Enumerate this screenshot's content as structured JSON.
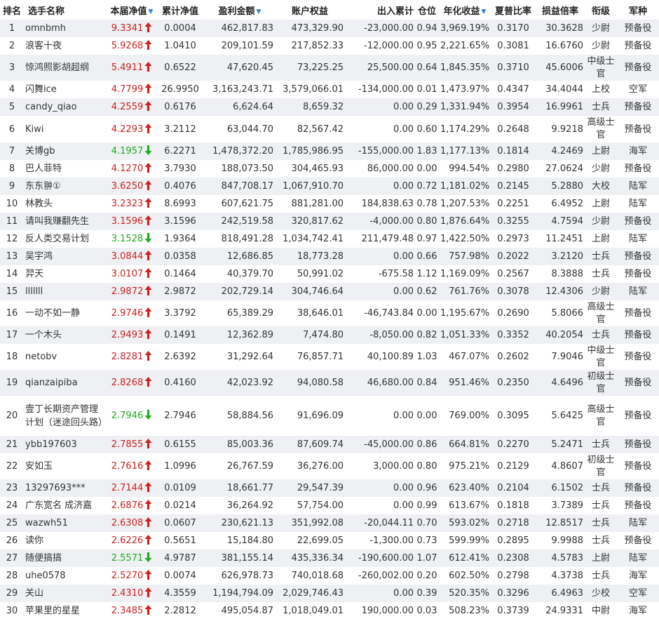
{
  "colors": {
    "up": "#cc2222",
    "down": "#22aa22",
    "sort_icon": "#2f7fd6",
    "stripe": "#eef0f3"
  },
  "headers": {
    "rank": "排名",
    "name": "选手名称",
    "nav": "本届净值",
    "cum_nav": "累计净值",
    "profit": "盈利金额",
    "equity": "账户权益",
    "inout": "出入累计",
    "position": "仓位",
    "annual": "年化收益",
    "sharpe": "夏普比率",
    "pl_ratio": "损益倍率",
    "rank_title": "衔级",
    "branch": "军种"
  },
  "sort_icons": {
    "nav": "sort-down-icon",
    "profit": "sort-down-icon",
    "annual": "sort-down-icon"
  },
  "rows": [
    {
      "rank": "1",
      "name": "omnbmh",
      "nav": "9.3341",
      "dir": "up",
      "cum_nav": "0.0004",
      "profit": "462,817.83",
      "equity": "473,329.90",
      "inout": "-23,000.00",
      "position": "0.94",
      "annual": "3,969.19%",
      "sharpe": "0.3170",
      "pl_ratio": "30.3628",
      "title": "少尉",
      "branch": "预备役"
    },
    {
      "rank": "2",
      "name": "浪客十夜",
      "nav": "5.9268",
      "dir": "up",
      "cum_nav": "1.0410",
      "profit": "209,101.59",
      "equity": "217,852.33",
      "inout": "-12,000.00",
      "position": "0.95",
      "annual": "2,221.65%",
      "sharpe": "0.3081",
      "pl_ratio": "16.6760",
      "title": "少尉",
      "branch": "预备役"
    },
    {
      "rank": "3",
      "name": "惊鸿照影胡超纲",
      "nav": "5.4911",
      "dir": "up",
      "cum_nav": "0.6522",
      "profit": "47,620.45",
      "equity": "73,225.25",
      "inout": "25,500.00",
      "position": "0.64",
      "annual": "1,845.35%",
      "sharpe": "0.3710",
      "pl_ratio": "45.6006",
      "title": "中级士官",
      "branch": "预备役"
    },
    {
      "rank": "4",
      "name": "闪舞ice",
      "nav": "4.7799",
      "dir": "up",
      "cum_nav": "26.9950",
      "profit": "3,163,243.71",
      "equity": "3,579,066.01",
      "inout": "-134,000.00",
      "position": "0.01",
      "annual": "1,473.97%",
      "sharpe": "0.4347",
      "pl_ratio": "34.4044",
      "title": "上校",
      "branch": "空军"
    },
    {
      "rank": "5",
      "name": "candy_qiao",
      "nav": "4.2559",
      "dir": "up",
      "cum_nav": "0.6176",
      "profit": "6,624.64",
      "equity": "8,659.32",
      "inout": "0.00",
      "position": "0.29",
      "annual": "1,331.94%",
      "sharpe": "0.3954",
      "pl_ratio": "16.9961",
      "title": "士兵",
      "branch": "预备役"
    },
    {
      "rank": "6",
      "name": "Kiwi",
      "nav": "4.2293",
      "dir": "up",
      "cum_nav": "3.2112",
      "profit": "63,044.70",
      "equity": "82,567.42",
      "inout": "0.00",
      "position": "0.60",
      "annual": "1,174.29%",
      "sharpe": "0.2648",
      "pl_ratio": "9.9218",
      "title": "高级士官",
      "branch": "预备役"
    },
    {
      "rank": "7",
      "name": "关博gb",
      "nav": "4.1957",
      "dir": "down",
      "cum_nav": "6.2271",
      "profit": "1,478,372.20",
      "equity": "1,785,986.95",
      "inout": "-155,000.00",
      "position": "1.83",
      "annual": "1,177.13%",
      "sharpe": "0.1814",
      "pl_ratio": "4.2469",
      "title": "上尉",
      "branch": "海军"
    },
    {
      "rank": "8",
      "name": "巴人菲特",
      "nav": "4.1270",
      "dir": "up",
      "cum_nav": "3.7930",
      "profit": "188,073.50",
      "equity": "304,465.93",
      "inout": "86,000.00",
      "position": "0.00",
      "annual": "994.54%",
      "sharpe": "0.2980",
      "pl_ratio": "27.0624",
      "title": "少尉",
      "branch": "预备役"
    },
    {
      "rank": "9",
      "name": "东东翀①",
      "nav": "3.6250",
      "dir": "up",
      "cum_nav": "0.4076",
      "profit": "847,708.17",
      "equity": "1,067,910.70",
      "inout": "0.00",
      "position": "0.72",
      "annual": "1,181.02%",
      "sharpe": "0.2145",
      "pl_ratio": "5.2880",
      "title": "大校",
      "branch": "陆军"
    },
    {
      "rank": "10",
      "name": "林教头",
      "nav": "3.2323",
      "dir": "up",
      "cum_nav": "8.6993",
      "profit": "607,621.75",
      "equity": "881,281.00",
      "inout": "184,838.63",
      "position": "0.78",
      "annual": "1,207.53%",
      "sharpe": "0.2251",
      "pl_ratio": "6.4952",
      "title": "上尉",
      "branch": "陆军"
    },
    {
      "rank": "11",
      "name": "请叫我赚翻先生",
      "nav": "3.1596",
      "dir": "up",
      "cum_nav": "3.1596",
      "profit": "242,519.58",
      "equity": "320,817.62",
      "inout": "-4,000.00",
      "position": "0.80",
      "annual": "1,876.64%",
      "sharpe": "0.3255",
      "pl_ratio": "4.7594",
      "title": "少尉",
      "branch": "预备役"
    },
    {
      "rank": "12",
      "name": "反人类交易计划",
      "nav": "3.1528",
      "dir": "down",
      "cum_nav": "1.9364",
      "profit": "818,491.28",
      "equity": "1,034,742.41",
      "inout": "211,479.48",
      "position": "0.97",
      "annual": "1,422.50%",
      "sharpe": "0.2973",
      "pl_ratio": "11.2451",
      "title": "上尉",
      "branch": "陆军"
    },
    {
      "rank": "13",
      "name": "吴宇鸿",
      "nav": "3.0844",
      "dir": "up",
      "cum_nav": "0.0358",
      "profit": "12,686.85",
      "equity": "18,773.28",
      "inout": "0.00",
      "position": "0.66",
      "annual": "757.98%",
      "sharpe": "0.2022",
      "pl_ratio": "3.2120",
      "title": "士兵",
      "branch": "预备役"
    },
    {
      "rank": "14",
      "name": "羿天",
      "nav": "3.0107",
      "dir": "up",
      "cum_nav": "0.1464",
      "profit": "40,379.70",
      "equity": "50,991.02",
      "inout": "-675.58",
      "position": "1.12",
      "annual": "1,169.09%",
      "sharpe": "0.2567",
      "pl_ratio": "8.3888",
      "title": "士兵",
      "branch": "预备役"
    },
    {
      "rank": "15",
      "name": "lllllll",
      "nav": "2.9872",
      "dir": "up",
      "cum_nav": "2.9872",
      "profit": "202,729.14",
      "equity": "304,746.64",
      "inout": "0.00",
      "position": "0.62",
      "annual": "761.76%",
      "sharpe": "0.3078",
      "pl_ratio": "12.4306",
      "title": "少尉",
      "branch": "陆军"
    },
    {
      "rank": "16",
      "name": "一动不如一静",
      "nav": "2.9746",
      "dir": "up",
      "cum_nav": "3.3792",
      "profit": "65,389.29",
      "equity": "38,646.01",
      "inout": "-46,743.84",
      "position": "0.00",
      "annual": "1,195.67%",
      "sharpe": "0.2690",
      "pl_ratio": "5.8066",
      "title": "高级士官",
      "branch": "预备役"
    },
    {
      "rank": "17",
      "name": "一个木头",
      "nav": "2.9493",
      "dir": "up",
      "cum_nav": "0.1491",
      "profit": "12,362.89",
      "equity": "7,474.80",
      "inout": "-8,050.00",
      "position": "0.82",
      "annual": "1,051.33%",
      "sharpe": "0.3352",
      "pl_ratio": "40.2054",
      "title": "士兵",
      "branch": "预备役"
    },
    {
      "rank": "18",
      "name": "netobv",
      "nav": "2.8281",
      "dir": "up",
      "cum_nav": "2.6392",
      "profit": "31,292.64",
      "equity": "76,857.71",
      "inout": "40,100.89",
      "position": "1.03",
      "annual": "467.07%",
      "sharpe": "0.2602",
      "pl_ratio": "7.9046",
      "title": "中级士官",
      "branch": "预备役"
    },
    {
      "rank": "19",
      "name": "qianzaipiba",
      "nav": "2.8268",
      "dir": "up",
      "cum_nav": "0.4160",
      "profit": "42,023.92",
      "equity": "94,080.58",
      "inout": "46,680.00",
      "position": "0.84",
      "annual": "951.46%",
      "sharpe": "0.2350",
      "pl_ratio": "4.6496",
      "title": "初级士官",
      "branch": "预备役"
    },
    {
      "rank": "20",
      "name": "壹丁长期资产管理计划（迷途回头路）",
      "nav": "2.7946",
      "dir": "down",
      "cum_nav": "2.7946",
      "profit": "58,884.56",
      "equity": "91,696.09",
      "inout": "0.00",
      "position": "0.00",
      "annual": "769.00%",
      "sharpe": "0.3095",
      "pl_ratio": "5.6425",
      "title": "高级士官",
      "branch": "预备役"
    },
    {
      "rank": "21",
      "name": "ybb197603",
      "nav": "2.7855",
      "dir": "up",
      "cum_nav": "0.6155",
      "profit": "85,003.36",
      "equity": "87,609.74",
      "inout": "-45,000.00",
      "position": "0.86",
      "annual": "664.81%",
      "sharpe": "0.2270",
      "pl_ratio": "5.2471",
      "title": "士兵",
      "branch": "预备役"
    },
    {
      "rank": "22",
      "name": "安如玉",
      "nav": "2.7616",
      "dir": "up",
      "cum_nav": "1.0996",
      "profit": "26,767.59",
      "equity": "36,276.00",
      "inout": "3,000.00",
      "position": "0.80",
      "annual": "975.21%",
      "sharpe": "0.2129",
      "pl_ratio": "4.8607",
      "title": "初级士官",
      "branch": "预备役"
    },
    {
      "rank": "23",
      "name": "13297693***",
      "nav": "2.7144",
      "dir": "up",
      "cum_nav": "0.0109",
      "profit": "18,661.77",
      "equity": "29,547.39",
      "inout": "0.00",
      "position": "0.96",
      "annual": "623.40%",
      "sharpe": "0.2104",
      "pl_ratio": "6.1502",
      "title": "士兵",
      "branch": "预备役"
    },
    {
      "rank": "24",
      "name": "广东宽名 成济嘉",
      "nav": "2.6876",
      "dir": "up",
      "cum_nav": "0.0214",
      "profit": "36,264.92",
      "equity": "57,754.00",
      "inout": "0.00",
      "position": "0.99",
      "annual": "613.67%",
      "sharpe": "0.1818",
      "pl_ratio": "3.7389",
      "title": "士兵",
      "branch": "预备役"
    },
    {
      "rank": "25",
      "name": "wazwh51",
      "nav": "2.6308",
      "dir": "up",
      "cum_nav": "0.0607",
      "profit": "230,621.13",
      "equity": "351,992.08",
      "inout": "-20,044.11",
      "position": "0.70",
      "annual": "593.02%",
      "sharpe": "0.2718",
      "pl_ratio": "12.8517",
      "title": "士兵",
      "branch": "陆军"
    },
    {
      "rank": "26",
      "name": "读你",
      "nav": "2.6226",
      "dir": "up",
      "cum_nav": "0.5651",
      "profit": "15,184.80",
      "equity": "22,699.05",
      "inout": "-1,300.00",
      "position": "0.73",
      "annual": "599.99%",
      "sharpe": "0.2895",
      "pl_ratio": "9.9988",
      "title": "士兵",
      "branch": "预备役"
    },
    {
      "rank": "27",
      "name": "随便搞搞",
      "nav": "2.5571",
      "dir": "down",
      "cum_nav": "4.9787",
      "profit": "381,155.14",
      "equity": "435,336.34",
      "inout": "-190,600.00",
      "position": "1.07",
      "annual": "612.41%",
      "sharpe": "0.2308",
      "pl_ratio": "4.5783",
      "title": "上尉",
      "branch": "陆军"
    },
    {
      "rank": "28",
      "name": "uhe0578",
      "nav": "2.5270",
      "dir": "up",
      "cum_nav": "0.0074",
      "profit": "626,978.73",
      "equity": "740,018.68",
      "inout": "-260,002.00",
      "position": "0.20",
      "annual": "602.50%",
      "sharpe": "0.2798",
      "pl_ratio": "4.3738",
      "title": "士兵",
      "branch": "海军"
    },
    {
      "rank": "29",
      "name": "关山",
      "nav": "2.4310",
      "dir": "up",
      "cum_nav": "4.3559",
      "profit": "1,194,794.09",
      "equity": "2,029,746.43",
      "inout": "0.00",
      "position": "0.39",
      "annual": "520.35%",
      "sharpe": "0.3296",
      "pl_ratio": "6.4963",
      "title": "少校",
      "branch": "空军"
    },
    {
      "rank": "30",
      "name": "苹果里的星星",
      "nav": "2.3485",
      "dir": "up",
      "cum_nav": "2.2812",
      "profit": "495,054.87",
      "equity": "1,018,049.01",
      "inout": "190,000.00",
      "position": "0.03",
      "annual": "508.23%",
      "sharpe": "0.3739",
      "pl_ratio": "24.9331",
      "title": "中尉",
      "branch": "海军"
    }
  ]
}
